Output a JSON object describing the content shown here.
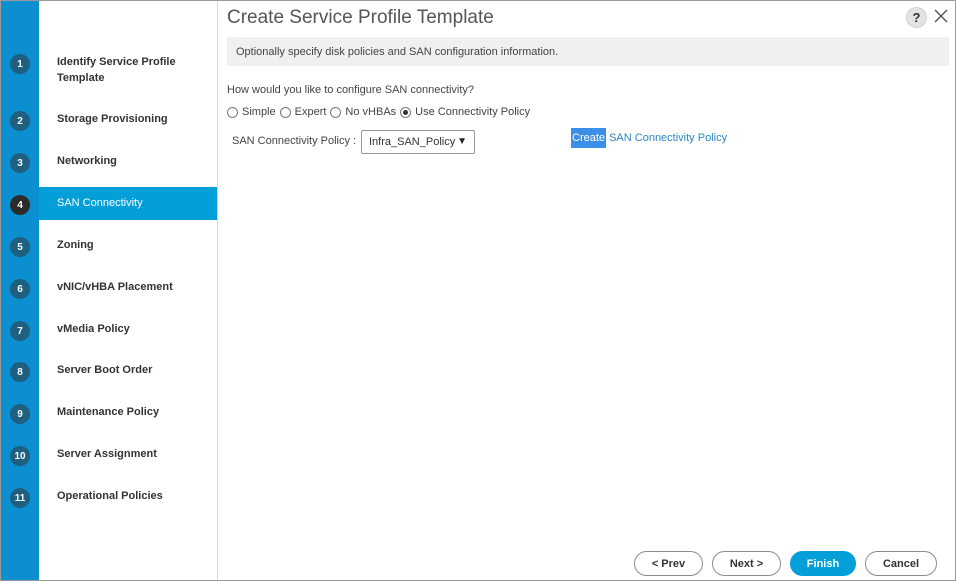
{
  "dialog": {
    "title": "Create Service Profile Template",
    "help_label": "?",
    "info_text": "Optionally specify disk policies and SAN configuration information."
  },
  "steps": [
    {
      "num": "1",
      "label": "Identify Service Profile Template"
    },
    {
      "num": "2",
      "label": "Storage Provisioning"
    },
    {
      "num": "3",
      "label": "Networking"
    },
    {
      "num": "4",
      "label": "SAN Connectivity"
    },
    {
      "num": "5",
      "label": "Zoning"
    },
    {
      "num": "6",
      "label": "vNIC/vHBA Placement"
    },
    {
      "num": "7",
      "label": "vMedia Policy"
    },
    {
      "num": "8",
      "label": "Server Boot Order"
    },
    {
      "num": "9",
      "label": "Maintenance Policy"
    },
    {
      "num": "10",
      "label": "Server Assignment"
    },
    {
      "num": "11",
      "label": "Operational Policies"
    }
  ],
  "active_step": "4",
  "form": {
    "question": "How would you like to configure SAN connectivity?",
    "options": [
      "Simple",
      "Expert",
      "No vHBAs",
      "Use Connectivity Policy"
    ],
    "selected_option": "Use Connectivity Policy",
    "policy_label": "SAN Connectivity Policy :",
    "policy_value": "Infra_SAN_Policy",
    "create_link_highlight": "Create",
    "create_link_rest": " SAN Connectivity Policy"
  },
  "buttons": {
    "prev": "< Prev",
    "next": "Next >",
    "finish": "Finish",
    "cancel": "Cancel"
  },
  "colors": {
    "accent": "#049fd9",
    "rail": "#0b8fd0",
    "step_circle": "#1f5f80",
    "link": "#2a87c2"
  }
}
